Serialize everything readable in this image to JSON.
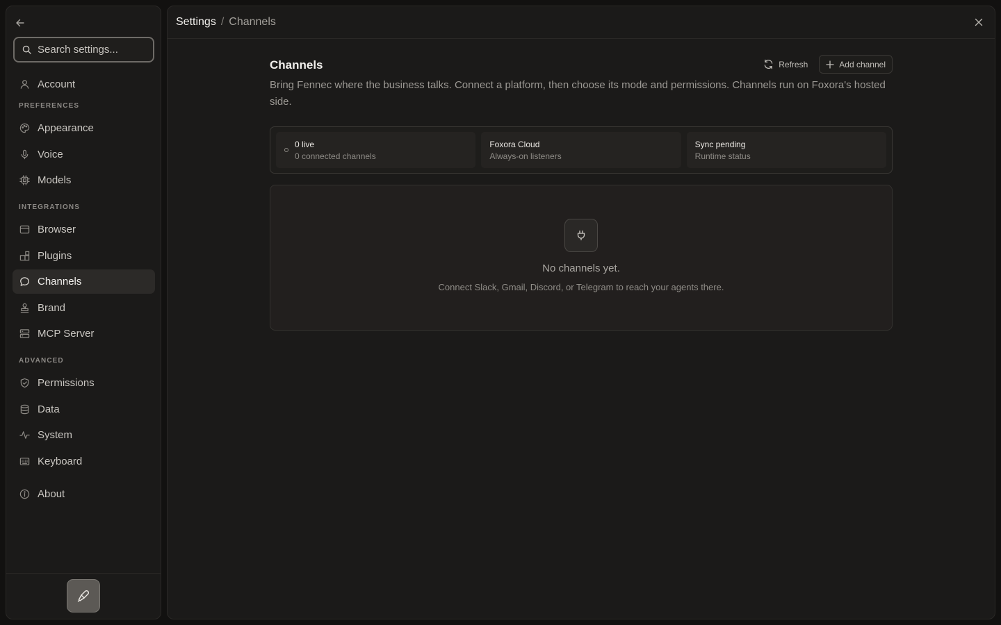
{
  "sidebar": {
    "search_placeholder": "Search settings...",
    "account_label": "Account",
    "sections": {
      "preferences": "PREFERENCES",
      "integrations": "INTEGRATIONS",
      "advanced": "ADVANCED"
    },
    "items": {
      "appearance": "Appearance",
      "voice": "Voice",
      "models": "Models",
      "browser": "Browser",
      "plugins": "Plugins",
      "channels": "Channels",
      "brand": "Brand",
      "mcp_server": "MCP Server",
      "permissions": "Permissions",
      "data": "Data",
      "system": "System",
      "keyboard": "Keyboard",
      "about": "About"
    },
    "active_item": "Channels"
  },
  "header": {
    "breadcrumb_root": "Settings",
    "breadcrumb_separator": "/",
    "breadcrumb_current": "Channels"
  },
  "content": {
    "title": "Channels",
    "description": "Bring Fennec where the business talks. Connect a platform, then choose its mode and permissions. Channels run on Foxora's hosted side.",
    "refresh_label": "Refresh",
    "add_channel_label": "Add channel",
    "stats": [
      {
        "title": "0 live",
        "subtitle": "0 connected channels"
      },
      {
        "title": "Foxora Cloud",
        "subtitle": "Always-on listeners"
      },
      {
        "title": "Sync pending",
        "subtitle": "Runtime status"
      }
    ],
    "empty_state": {
      "icon": "plug-icon",
      "title": "No channels yet.",
      "subtitle": "Connect Slack, Gmail, Discord, or Telegram to reach your agents there."
    }
  },
  "colors": {
    "background": "#121110",
    "panel": "#1b1a19",
    "active_item": "#2c2a28"
  }
}
